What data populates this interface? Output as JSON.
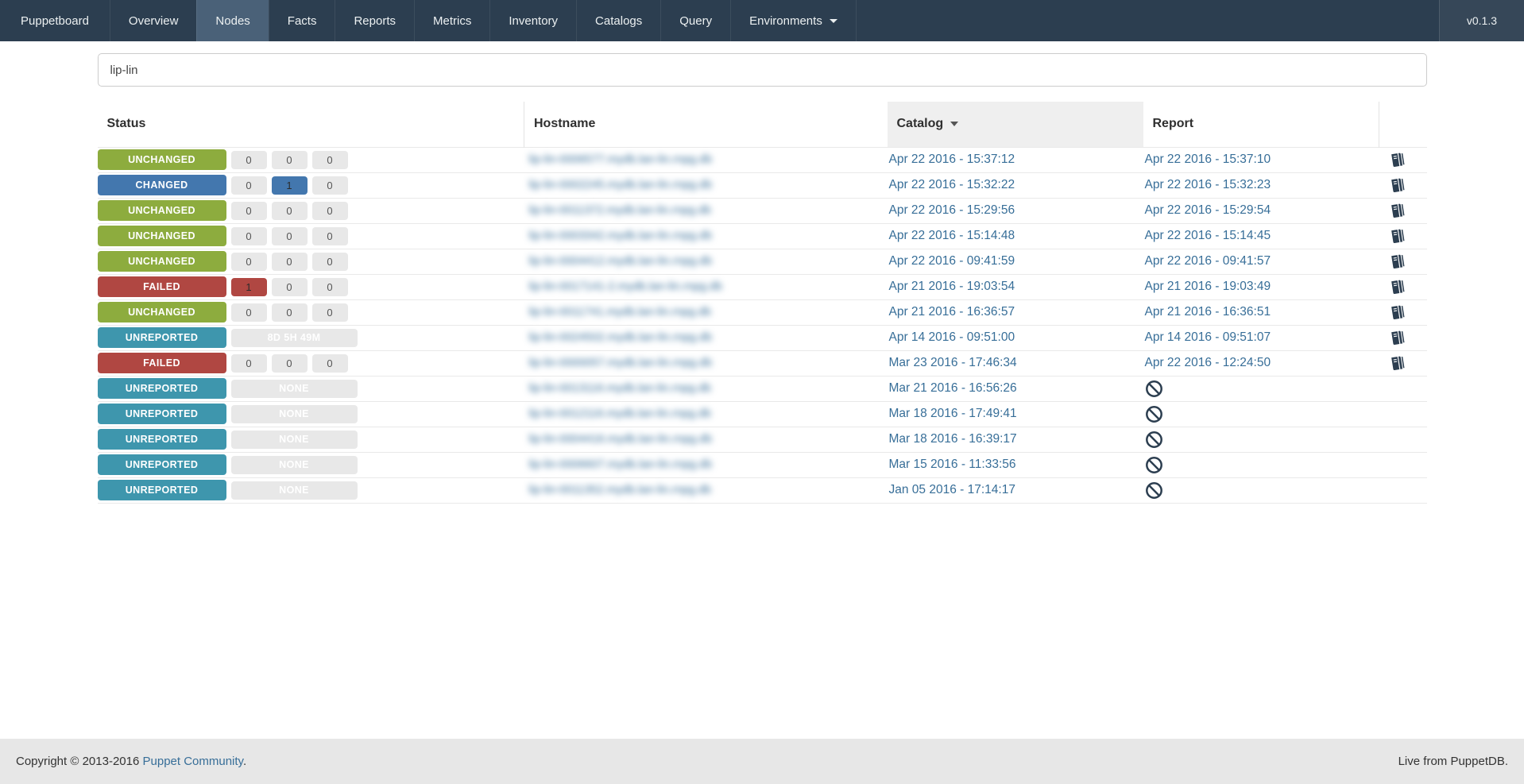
{
  "nav": {
    "brand": "Puppetboard",
    "items": [
      "Overview",
      "Nodes",
      "Facts",
      "Reports",
      "Metrics",
      "Inventory",
      "Catalogs",
      "Query"
    ],
    "active_item": "Nodes",
    "dropdown": {
      "label": "Environments"
    },
    "version": "v0.1.3"
  },
  "search": {
    "value": "lip-lin"
  },
  "table": {
    "columns": [
      "Status",
      "Hostname",
      "Catalog",
      "Report"
    ],
    "sort": {
      "column": "Catalog",
      "direction": "desc"
    },
    "hostnames_blurred": true,
    "rows": [
      {
        "status": "UNCHANGED",
        "variant": "unchanged",
        "counters": [
          "0",
          "0",
          "0"
        ],
        "highlight_index": null,
        "counter_wide": null,
        "hostname_placeholder": "lip-lin-0006577.mydb.lan-lin.rnpg.db",
        "catalog": "Apr 22 2016 - 15:37:12",
        "report": "Apr 22 2016 - 15:37:10",
        "icon": "book"
      },
      {
        "status": "CHANGED",
        "variant": "changed",
        "counters": [
          "0",
          "1",
          "0"
        ],
        "highlight_index": 1,
        "counter_wide": null,
        "hostname_placeholder": "lip-lin-0002245.mydb.lan-lin.rnpg.db",
        "catalog": "Apr 22 2016 - 15:32:22",
        "report": "Apr 22 2016 - 15:32:23",
        "icon": "book"
      },
      {
        "status": "UNCHANGED",
        "variant": "unchanged",
        "counters": [
          "0",
          "0",
          "0"
        ],
        "highlight_index": null,
        "counter_wide": null,
        "hostname_placeholder": "lip-lin-0011372.mydb.lan-lin.rnpg.db",
        "catalog": "Apr 22 2016 - 15:29:56",
        "report": "Apr 22 2016 - 15:29:54",
        "icon": "book"
      },
      {
        "status": "UNCHANGED",
        "variant": "unchanged",
        "counters": [
          "0",
          "0",
          "0"
        ],
        "highlight_index": null,
        "counter_wide": null,
        "hostname_placeholder": "lip-lin-0003342.mydb.lan-lin.rnpg.db",
        "catalog": "Apr 22 2016 - 15:14:48",
        "report": "Apr 22 2016 - 15:14:45",
        "icon": "book"
      },
      {
        "status": "UNCHANGED",
        "variant": "unchanged",
        "counters": [
          "0",
          "0",
          "0"
        ],
        "highlight_index": null,
        "counter_wide": null,
        "hostname_placeholder": "lip-lin-0004412.mydb.lan-lin.rnpg.db",
        "catalog": "Apr 22 2016 - 09:41:59",
        "report": "Apr 22 2016 - 09:41:57",
        "icon": "book"
      },
      {
        "status": "FAILED",
        "variant": "failed",
        "counters": [
          "1",
          "0",
          "0"
        ],
        "highlight_index": 0,
        "counter_wide": null,
        "hostname_placeholder": "lip-lin-0017141-2.mydb.lan-lin.rnpg.db",
        "catalog": "Apr 21 2016 - 19:03:54",
        "report": "Apr 21 2016 - 19:03:49",
        "icon": "book"
      },
      {
        "status": "UNCHANGED",
        "variant": "unchanged",
        "counters": [
          "0",
          "0",
          "0"
        ],
        "highlight_index": null,
        "counter_wide": null,
        "hostname_placeholder": "lip-lin-0011741.mydb.lan-lin.rnpg.db",
        "catalog": "Apr 21 2016 - 16:36:57",
        "report": "Apr 21 2016 - 16:36:51",
        "icon": "book"
      },
      {
        "status": "UNREPORTED",
        "variant": "unreported",
        "counters": null,
        "highlight_index": null,
        "counter_wide": "8D 5H 49M",
        "hostname_placeholder": "lip-lin-0024502.mydb.lan-lin.rnpg.db",
        "catalog": "Apr 14 2016 - 09:51:00",
        "report": "Apr 14 2016 - 09:51:07",
        "icon": "book"
      },
      {
        "status": "FAILED",
        "variant": "failed",
        "counters": [
          "0",
          "0",
          "0"
        ],
        "highlight_index": null,
        "counter_wide": null,
        "hostname_placeholder": "lip-lin-0000057.mydb.lan-lin.rnpg.db",
        "catalog": "Mar 23 2016 - 17:46:34",
        "report": "Apr 22 2016 - 12:24:50",
        "icon": "book"
      },
      {
        "status": "UNREPORTED",
        "variant": "unreported",
        "counters": null,
        "highlight_index": null,
        "counter_wide": "NONE",
        "hostname_placeholder": "lip-lin-0013116.mydb.lan-lin.rnpg.db",
        "catalog": "Mar 21 2016 - 16:56:26",
        "report": null,
        "icon": "ban"
      },
      {
        "status": "UNREPORTED",
        "variant": "unreported",
        "counters": null,
        "highlight_index": null,
        "counter_wide": "NONE",
        "hostname_placeholder": "lip-lin-0012116.mydb.lan-lin.rnpg.db",
        "catalog": "Mar 18 2016 - 17:49:41",
        "report": null,
        "icon": "ban"
      },
      {
        "status": "UNREPORTED",
        "variant": "unreported",
        "counters": null,
        "highlight_index": null,
        "counter_wide": "NONE",
        "hostname_placeholder": "lip-lin-0004416.mydb.lan-lin.rnpg.db",
        "catalog": "Mar 18 2016 - 16:39:17",
        "report": null,
        "icon": "ban"
      },
      {
        "status": "UNREPORTED",
        "variant": "unreported",
        "counters": null,
        "highlight_index": null,
        "counter_wide": "NONE",
        "hostname_placeholder": "lip-lin-0006607.mydb.lan-lin.rnpg.db",
        "catalog": "Mar 15 2016 - 11:33:56",
        "report": null,
        "icon": "ban"
      },
      {
        "status": "UNREPORTED",
        "variant": "unreported",
        "counters": null,
        "highlight_index": null,
        "counter_wide": "NONE",
        "hostname_placeholder": "lip-lin-0011352.mydb.lan-lin.rnpg.db",
        "catalog": "Jan 05 2016 - 17:14:17",
        "report": null,
        "icon": "ban"
      }
    ]
  },
  "colors": {
    "navbar": "#2c3e50",
    "navbar_active": "#4a6178",
    "unchanged": "#8dac3e",
    "changed": "#4377ae",
    "failed": "#b04742",
    "unreported": "#3e96ad",
    "link": "#376e98",
    "catalog_header_bg": "#efefef",
    "footer_bg": "#e7e7e7"
  },
  "icons": {
    "report_available": "book-icon",
    "report_missing": "ban-icon",
    "dropdown": "chevron-down-icon",
    "sort": "sort-desc-caret-icon"
  },
  "footer": {
    "copyright": "Copyright © 2013-2016 ",
    "community_link": "Puppet Community",
    "period": ".",
    "live_text": "Live from PuppetDB."
  }
}
